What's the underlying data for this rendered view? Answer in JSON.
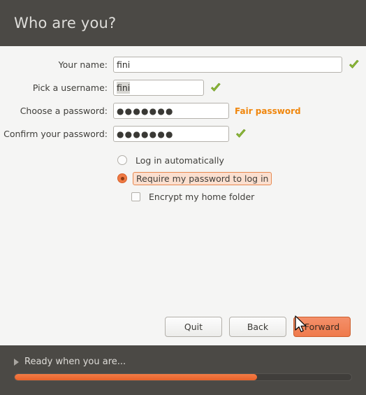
{
  "header": {
    "title": "Who are you?"
  },
  "form": {
    "fields": [
      {
        "label": "Your name:",
        "value": "fini",
        "status_icon": "green-check-icon",
        "status_text": ""
      },
      {
        "label": "Pick a username:",
        "value": "fini",
        "status_icon": "green-check-icon",
        "status_text": ""
      },
      {
        "label": "Choose a password:",
        "value": "●●●●●●●",
        "status_icon": "",
        "status_text": "Fair password"
      },
      {
        "label": "Confirm your password:",
        "value": "●●●●●●●",
        "status_icon": "green-check-icon",
        "status_text": ""
      }
    ]
  },
  "options": {
    "login_auto": {
      "label": "Log in automatically",
      "selected": false
    },
    "require_password": {
      "label": "Require my password to log in",
      "selected": true,
      "focused": true
    },
    "encrypt_home": {
      "label": "Encrypt my home folder",
      "checked": false
    }
  },
  "buttons": {
    "quit": "Quit",
    "back": "Back",
    "forward": "Forward"
  },
  "footer": {
    "status": "Ready when you are...",
    "progress_percent": 72
  },
  "colors": {
    "header_bg": "#4b4945",
    "body_bg": "#f5f5f4",
    "accent_orange": "#ef7a4c",
    "strength_text": "#f0860c",
    "check_green": "#8fba3a"
  }
}
